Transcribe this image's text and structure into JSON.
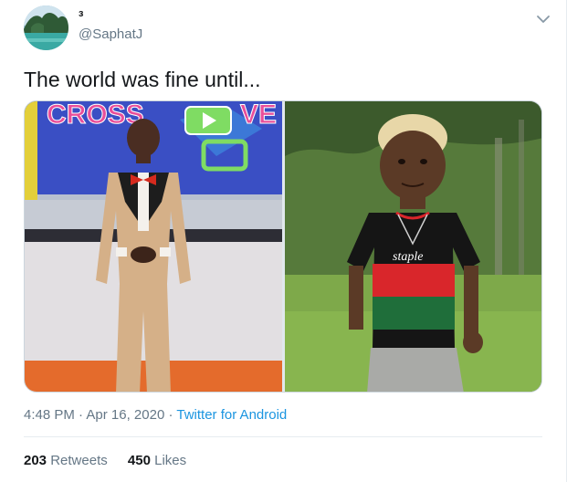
{
  "author": {
    "display_name": "з",
    "handle": "@SaphatJ"
  },
  "icons": {
    "caret": "chevron-down-icon"
  },
  "tweet": {
    "text": "The world was fine until...",
    "time": "4:48 PM",
    "date": "Apr 16, 2020",
    "source": "Twitter for Android",
    "separator": "·"
  },
  "media": {
    "left_photo": {
      "sign_text": "CROSS",
      "sign_text_2": "VE"
    },
    "right_photo": {
      "shirt_text": "staple"
    }
  },
  "stats": {
    "retweets_count": "203",
    "retweets_label": "Retweets",
    "likes_count": "450",
    "likes_label": "Likes"
  },
  "colors": {
    "link": "#1b95e0",
    "secondary_text": "#657786",
    "primary_text": "#14171a",
    "border": "#e6ecf0"
  }
}
